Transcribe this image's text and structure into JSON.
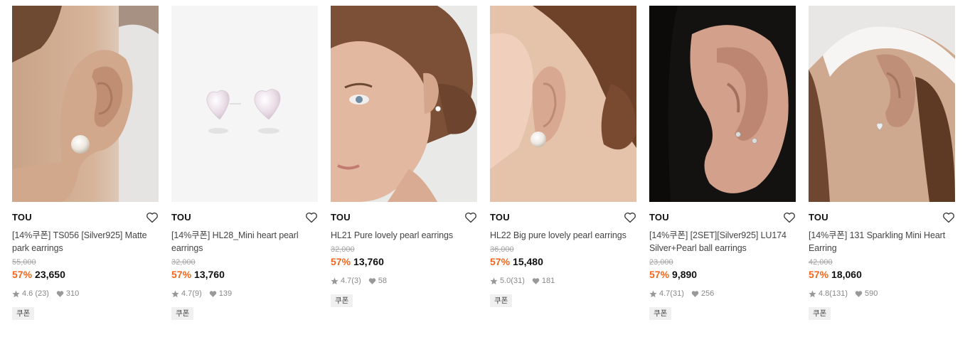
{
  "products": [
    {
      "brand": "TOU",
      "name": "[14%쿠폰] TS056 [Silver925] Matte park earrings",
      "original_price": "55,000",
      "discount": "57%",
      "price": "23,650",
      "rating": "4.6",
      "reviews": "(23)",
      "likes": "310",
      "badge": "쿠폰"
    },
    {
      "brand": "TOU",
      "name": "[14%쿠폰] HL28_Mini heart pearl earrings",
      "original_price": "32,000",
      "discount": "57%",
      "price": "13,760",
      "rating": "4.7",
      "reviews": "(9)",
      "likes": "139",
      "badge": "쿠폰"
    },
    {
      "brand": "TOU",
      "name": "HL21 Pure lovely pearl earrings",
      "original_price": "32,000",
      "discount": "57%",
      "price": "13,760",
      "rating": "4.7",
      "reviews": "(3)",
      "likes": "58",
      "badge": "쿠폰"
    },
    {
      "brand": "TOU",
      "name": "HL22 Big pure lovely pearl earrings",
      "original_price": "36,000",
      "discount": "57%",
      "price": "15,480",
      "rating": "5.0",
      "reviews": "(31)",
      "likes": "181",
      "badge": "쿠폰"
    },
    {
      "brand": "TOU",
      "name": "[14%쿠폰] [2SET][Silver925] LU174 Silver+Pearl ball earrings",
      "original_price": "23,000",
      "discount": "57%",
      "price": "9,890",
      "rating": "4.7",
      "reviews": "(31)",
      "likes": "256",
      "badge": "쿠폰"
    },
    {
      "brand": "TOU",
      "name": "[14%쿠폰] 131 Sparkling Mini Heart Earring",
      "original_price": "42,000",
      "discount": "57%",
      "price": "18,060",
      "rating": "4.8",
      "reviews": "(131)",
      "likes": "590",
      "badge": "쿠폰"
    }
  ],
  "icons": {
    "wishlist": "heart-outline-icon",
    "rating": "star-icon",
    "likes": "heart-filled-icon"
  },
  "colors": {
    "discount": "#f2671c",
    "muted": "#888888",
    "badge_bg": "#f0f0f0"
  }
}
